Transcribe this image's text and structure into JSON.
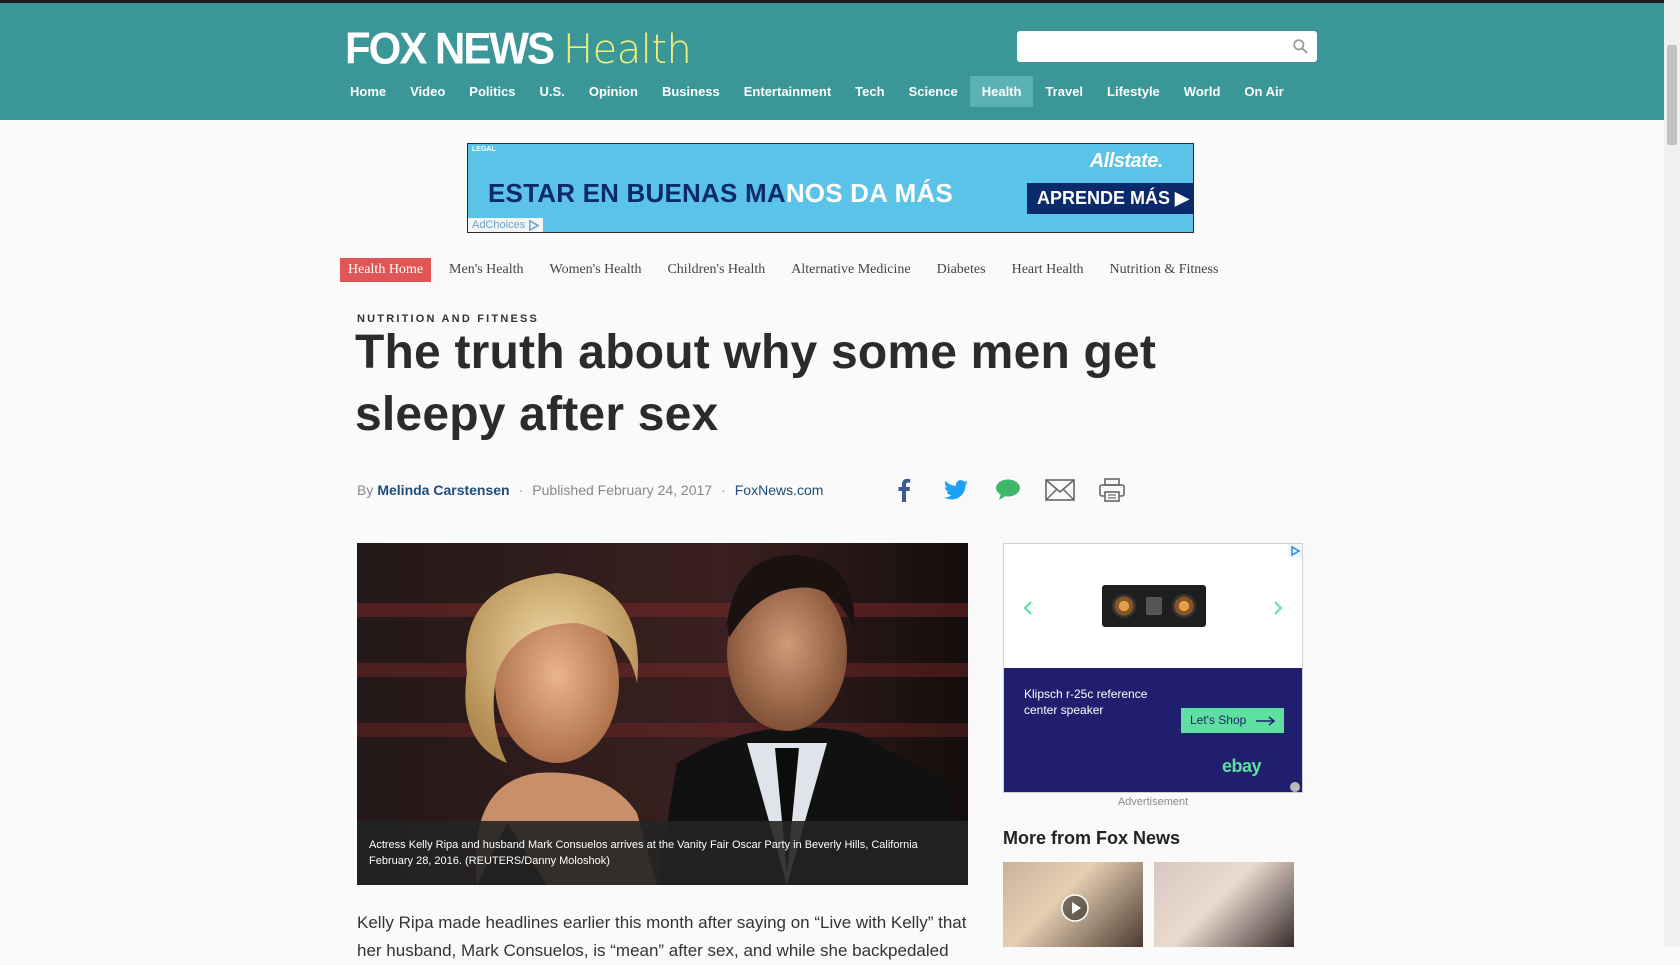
{
  "header": {
    "logo_main": "FOX NEWS",
    "logo_section": "Health",
    "search": {
      "placeholder": "",
      "icon": "search-icon"
    },
    "nav": [
      "Home",
      "Video",
      "Politics",
      "U.S.",
      "Opinion",
      "Business",
      "Entertainment",
      "Tech",
      "Science",
      "Health",
      "Travel",
      "Lifestyle",
      "World",
      "On Air"
    ],
    "nav_active": "Health",
    "colors": {
      "bar": "#3b9797",
      "logo_section": "#f3f07a",
      "active_tab": "#5cb2b2"
    }
  },
  "top_ad": {
    "legal": "LEGAL",
    "headline_part1": "ESTAR EN BUENAS MA",
    "headline_part2": "NOS DA MÁS",
    "brand": "Allstate.",
    "cta": "APRENDE MÁS",
    "adchoices": "AdChoices"
  },
  "subnav": {
    "items": [
      "Health Home",
      "Men's Health",
      "Women's Health",
      "Children's Health",
      "Alternative Medicine",
      "Diabetes",
      "Heart Health",
      "Nutrition & Fitness"
    ],
    "active": "Health Home"
  },
  "article": {
    "kicker": "NUTRITION AND FITNESS",
    "title": "The truth about why some men get sleepy after sex",
    "by": "By",
    "author": "Melinda Carstensen",
    "published": "Published February 24, 2017",
    "source": "FoxNews.com",
    "share_icons": [
      "facebook-icon",
      "twitter-icon",
      "comment-icon",
      "email-icon",
      "print-icon"
    ],
    "caption": "Actress Kelly Ripa and husband Mark Consuelos arrives at the Vanity Fair Oscar Party in Beverly Hills, California February 28, 2016.  (REUTERS/Danny Moloshok)",
    "body_first": "Kelly Ripa made headlines earlier this month after saying on “Live with Kelly” that her husband, Mark Consuelos, is “mean” after sex, and while she backpedaled"
  },
  "side_ad": {
    "product": "Klipsch r-25c reference center speaker",
    "cta": "Let's Shop",
    "brand": "ebay",
    "label": "Advertisement"
  },
  "more": {
    "title": "More from Fox News"
  }
}
